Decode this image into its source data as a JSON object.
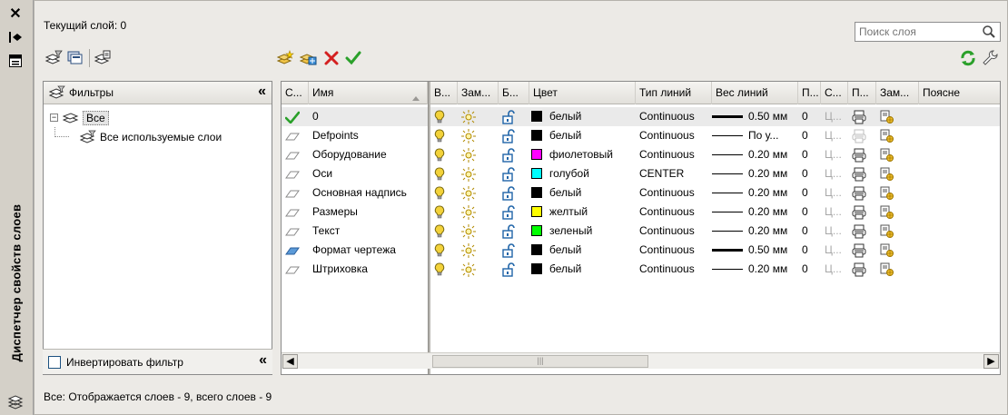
{
  "title_strip": {
    "title": "Диспетчер свойств слоев",
    "close_glyph": "✕",
    "autohide_glyph": "⇹",
    "properties_glyph": "▤"
  },
  "header": {
    "current_layer": "Текущий слой: 0",
    "search_placeholder": "Поиск слоя"
  },
  "filters": {
    "title": "Фильтры",
    "tree": [
      {
        "label": "Все",
        "level": 0,
        "selected": true
      },
      {
        "label": "Все используемые слои",
        "level": 1,
        "selected": false
      }
    ],
    "invert_label": "Инвертировать фильтр"
  },
  "grid": {
    "columns": [
      "С...",
      "Имя",
      "В...",
      "Зам...",
      "Б...",
      "Цвет",
      "Тип линий",
      "Вес линий",
      "П...",
      "С...",
      "П...",
      "Зам...",
      "Поясне"
    ],
    "rows": [
      {
        "status": "current",
        "name": "0",
        "color": "белый",
        "swatch": "#000000",
        "linetype": "Continuous",
        "weight": "0.50 мм",
        "thick": true,
        "transp": "0",
        "plotstyle": "Ц...",
        "plot_enabled": true
      },
      {
        "status": "normal",
        "name": "Defpoints",
        "color": "белый",
        "swatch": "#000000",
        "linetype": "Continuous",
        "weight": "По у...",
        "thick": false,
        "transp": "0",
        "plotstyle": "Ц...",
        "plot_enabled": false
      },
      {
        "status": "normal",
        "name": "Оборудование",
        "color": "фиолетовый",
        "swatch": "#ff00ff",
        "linetype": "Continuous",
        "weight": "0.20 мм",
        "thick": false,
        "transp": "0",
        "plotstyle": "Ц...",
        "plot_enabled": true
      },
      {
        "status": "normal",
        "name": "Оси",
        "color": "голубой",
        "swatch": "#00ffff",
        "linetype": "CENTER",
        "weight": "0.20 мм",
        "thick": false,
        "transp": "0",
        "plotstyle": "Ц...",
        "plot_enabled": true
      },
      {
        "status": "normal",
        "name": "Основная надпись",
        "color": "белый",
        "swatch": "#000000",
        "linetype": "Continuous",
        "weight": "0.20 мм",
        "thick": false,
        "transp": "0",
        "plotstyle": "Ц...",
        "plot_enabled": true
      },
      {
        "status": "normal",
        "name": "Размеры",
        "color": "желтый",
        "swatch": "#ffff00",
        "linetype": "Continuous",
        "weight": "0.20 мм",
        "thick": false,
        "transp": "0",
        "plotstyle": "Ц...",
        "plot_enabled": true
      },
      {
        "status": "normal",
        "name": "Текст",
        "color": "зеленый",
        "swatch": "#00ff00",
        "linetype": "Continuous",
        "weight": "0.20 мм",
        "thick": false,
        "transp": "0",
        "plotstyle": "Ц...",
        "plot_enabled": true
      },
      {
        "status": "used",
        "name": "Формат чертежа",
        "color": "белый",
        "swatch": "#000000",
        "linetype": "Continuous",
        "weight": "0.50 мм",
        "thick": true,
        "transp": "0",
        "plotstyle": "Ц...",
        "plot_enabled": true
      },
      {
        "status": "normal",
        "name": "Штриховка",
        "color": "белый",
        "swatch": "#000000",
        "linetype": "Continuous",
        "weight": "0.20 мм",
        "thick": false,
        "transp": "0",
        "plotstyle": "Ц...",
        "plot_enabled": true
      }
    ]
  },
  "scroll": {
    "left_glyph": "◀",
    "right_glyph": "▶",
    "thumb_glyph": "|||"
  },
  "status_bar": "Все: Отображается слоев - 9, всего слоев - 9",
  "colors": {
    "accent_green": "#2aa02a",
    "delete_red": "#d42020",
    "bulb_yellow": "#f3d23a",
    "lock_blue": "#1f64a8"
  }
}
